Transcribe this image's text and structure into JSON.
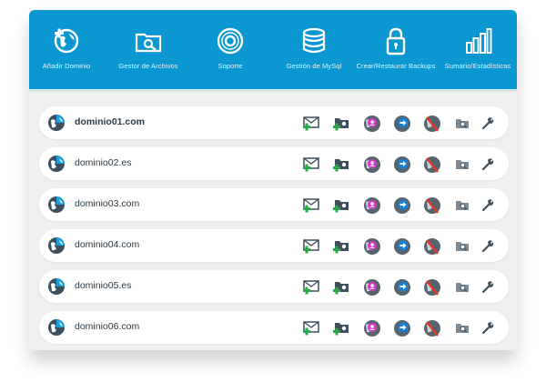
{
  "toolbar": {
    "items": [
      {
        "label": "Añadir Dominio",
        "icon": "add-globe-icon"
      },
      {
        "label": "Gestor de Archivos",
        "icon": "folder-search-icon"
      },
      {
        "label": "Soporte",
        "icon": "lifebuoy-icon"
      },
      {
        "label": "Gestión de MySql",
        "icon": "database-icon"
      },
      {
        "label": "Crear/Restaurar Backups",
        "icon": "lock-icon"
      },
      {
        "label": "Sumario/Estadísticas",
        "icon": "bar-chart-icon"
      }
    ]
  },
  "domains": [
    {
      "name": "dominio01.com",
      "bold": true
    },
    {
      "name": "dominio02.es",
      "bold": false
    },
    {
      "name": "dominio03.com",
      "bold": false
    },
    {
      "name": "dominio04.com",
      "bold": false
    },
    {
      "name": "dominio05.es",
      "bold": false
    },
    {
      "name": "dominio06.com",
      "bold": false
    }
  ],
  "row_actions": [
    "add-email-icon",
    "add-folder-icon",
    "user-globe-icon",
    "redirect-globe-icon",
    "disable-globe-icon",
    "search-folder-icon",
    "wrench-icon"
  ],
  "colors": {
    "toolbar": "#0b97d1",
    "panel": "#efefef",
    "green_plus": "#2aa84a",
    "magenta": "#e034c8",
    "blue": "#1a7fd0",
    "red": "#e0392b"
  }
}
